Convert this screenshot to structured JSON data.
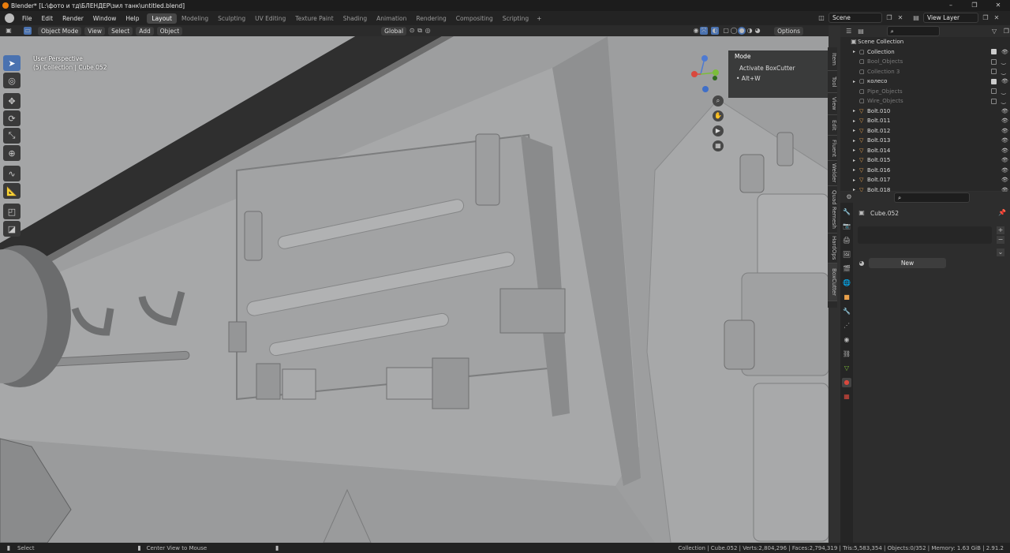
{
  "window": {
    "title": "Blender* [L:\\фото и тд\\БЛЕНДЕР\\зил танк\\untitled.blend]",
    "controls": [
      "–",
      "❐",
      "✕"
    ]
  },
  "menus": [
    "File",
    "Edit",
    "Render",
    "Window",
    "Help"
  ],
  "workspaces": [
    "Layout",
    "Modeling",
    "Sculpting",
    "UV Editing",
    "Texture Paint",
    "Shading",
    "Animation",
    "Rendering",
    "Compositing",
    "Scripting"
  ],
  "active_workspace": "Layout",
  "scene": {
    "name": "Scene",
    "view_layer": "View Layer"
  },
  "viewport_header": {
    "mode": "Object Mode",
    "menus": [
      "View",
      "Select",
      "Add",
      "Object"
    ],
    "transform_orientation": "Global",
    "options_label": "Options"
  },
  "viewport": {
    "perspective": "User Perspective",
    "selection_info": "(5) Collection | Cube.052"
  },
  "npanel": {
    "title": "Mode",
    "action": "Activate BoxCutter",
    "shortcut": "• Alt+W"
  },
  "sidebar_tabs": [
    "Item",
    "Tool",
    "View",
    "Edit",
    "Fluent",
    "Welder",
    "Quad Remesh",
    "HardOps",
    "BoxCutter"
  ],
  "outliner": {
    "root": "Scene Collection",
    "rows": [
      {
        "name": "Collection",
        "level": 1,
        "type": "collection",
        "checked": true,
        "dim": false
      },
      {
        "name": "Bool_Objects",
        "level": 1,
        "type": "collection",
        "checked": false,
        "dim": true
      },
      {
        "name": "Collection 3",
        "level": 1,
        "type": "collection",
        "checked": false,
        "dim": true
      },
      {
        "name": "колесо",
        "level": 1,
        "type": "collection",
        "checked": true,
        "dim": false
      },
      {
        "name": "Pipe_Objects",
        "level": 1,
        "type": "collection",
        "checked": false,
        "dim": true
      },
      {
        "name": "Wire_Objects",
        "level": 1,
        "type": "collection",
        "checked": false,
        "dim": true
      },
      {
        "name": "Bolt.010",
        "level": 1,
        "type": "mesh",
        "checked": null,
        "dim": false
      },
      {
        "name": "Bolt.011",
        "level": 1,
        "type": "mesh",
        "checked": null,
        "dim": false
      },
      {
        "name": "Bolt.012",
        "level": 1,
        "type": "mesh",
        "checked": null,
        "dim": false
      },
      {
        "name": "Bolt.013",
        "level": 1,
        "type": "mesh",
        "checked": null,
        "dim": false
      },
      {
        "name": "Bolt.014",
        "level": 1,
        "type": "mesh",
        "checked": null,
        "dim": false
      },
      {
        "name": "Bolt.015",
        "level": 1,
        "type": "mesh",
        "checked": null,
        "dim": false
      },
      {
        "name": "Bolt.016",
        "level": 1,
        "type": "mesh",
        "checked": null,
        "dim": false
      },
      {
        "name": "Bolt.017",
        "level": 1,
        "type": "mesh",
        "checked": null,
        "dim": false
      },
      {
        "name": "Bolt.018",
        "level": 1,
        "type": "mesh",
        "checked": null,
        "dim": false
      }
    ]
  },
  "properties": {
    "object_name": "Cube.052",
    "new_label": "New"
  },
  "statusbar": {
    "left": "Select",
    "middle": "Center View to Mouse",
    "stats": "Collection | Cube.052 | Verts:2,804,296 | Faces:2,794,319 | Tris:5,583,354 | Objects:0/352 | Memory: 1.63 GiB | 2.91.2"
  }
}
